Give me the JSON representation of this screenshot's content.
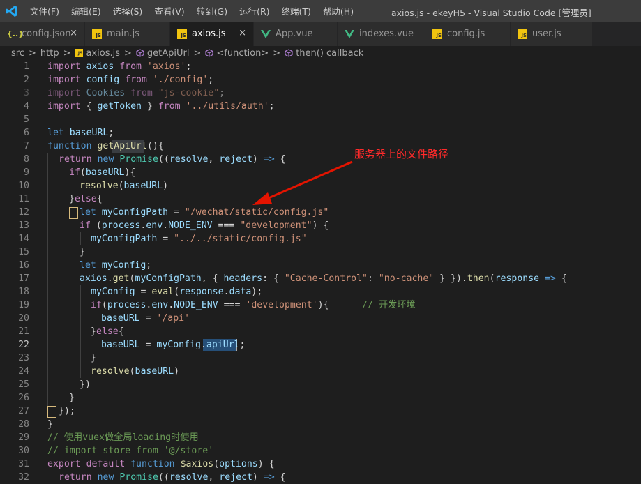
{
  "menu": [
    "文件(F)",
    "编辑(E)",
    "选择(S)",
    "查看(V)",
    "转到(G)",
    "运行(R)",
    "终端(T)",
    "帮助(H)"
  ],
  "window_title": "axios.js - ekeyH5 - Visual Studio Code [管理员]",
  "tabs": [
    {
      "label": "config.json",
      "icon": "json-file-icon",
      "close": "×"
    },
    {
      "label": "main.js",
      "icon": "js-file-icon"
    },
    {
      "label": "axios.js",
      "icon": "js-file-icon",
      "close": "×",
      "active": true
    },
    {
      "label": "App.vue",
      "icon": "vue-file-icon"
    },
    {
      "label": "indexes.vue",
      "icon": "vue-file-icon"
    },
    {
      "label": "config.js",
      "icon": "js-file-icon"
    },
    {
      "label": "user.js",
      "icon": "js-file-icon"
    }
  ],
  "breadcrumb": {
    "sep": ">",
    "items": [
      "src",
      "http",
      "axios.js",
      "getApiUrl",
      "<function>",
      "then() callback"
    ]
  },
  "line_numbers": [
    "1",
    "2",
    "3",
    "4",
    "5",
    "6",
    "7",
    "8",
    "9",
    "10",
    "11",
    "12",
    "13",
    "14",
    "15",
    "16",
    "17",
    "18",
    "19",
    "20",
    "21",
    "22",
    "23",
    "24",
    "25",
    "26",
    "27",
    "28",
    "29",
    "30",
    "31",
    "32"
  ],
  "code": {
    "l1_a": "import ",
    "l1_b": "axios",
    "l1_c": " from ",
    "l1_d": "'axios'",
    "l1_e": ";",
    "l2_a": "import ",
    "l2_b": "config",
    "l2_c": " from ",
    "l2_d": "'./config'",
    "l2_e": ";",
    "l3_a": "import ",
    "l3_b": "Cookies",
    "l3_c": " from ",
    "l3_d": "\"js-cookie\"",
    "l3_e": ";",
    "l4_a": "import ",
    "l4_b": "{ ",
    "l4_c": "getToken",
    "l4_d": " } ",
    "l4_e": "from ",
    "l4_f": "'../utils/auth'",
    "l4_g": ";",
    "l6_a": "let ",
    "l6_b": "baseURL",
    "l6_c": ";",
    "l7_a": "function ",
    "l7_b": "getApiUrl",
    "l7_c": "(){",
    "l8_a": "return ",
    "l8_b": "new ",
    "l8_c": "Promise",
    "l8_d": "((",
    "l8_e": "resolve",
    "l8_f": ", ",
    "l8_g": "reject",
    "l8_h": ") ",
    "l8_i": "=>",
    "l8_j": " {",
    "l9_a": "if",
    "l9_b": "(",
    "l9_c": "baseURL",
    "l9_d": "){",
    "l10_a": "resolve",
    "l10_b": "(",
    "l10_c": "baseURL",
    "l10_d": ")",
    "l11_a": "}",
    "l11_b": "else",
    "l11_c": "{",
    "l12_a": "let ",
    "l12_b": "myConfigPath",
    " l12_c": " = ",
    "l12_d": "\"/wechat/static/config.js\"",
    "l13_a": "if ",
    "l13_b": "(",
    "l13_c": "process",
    "l13_d": ".",
    "l13_e": "env",
    "l13_f": ".",
    "l13_g": "NODE_ENV",
    " l13_h": " === ",
    "l13_i": "\"development\"",
    "l13_j": ") {",
    "l14_a": "myConfigPath",
    "l14_b": " = ",
    "l14_c": "\"../../static/config.js\"",
    "l15_a": "}",
    "l16_a": "let ",
    "l16_b": "myConfig",
    "l16_c": ";",
    "l17_a": "axios",
    "l17_b": ".",
    "l17_c": "get",
    "l17_d": "(",
    "l17_e": "myConfigPath",
    "l17_f": ", { ",
    "l17_g": "headers",
    "l17_h": ": { ",
    "l17_i": "\"Cache-Control\"",
    "l17_j": ": ",
    "l17_k": "\"no-cache\"",
    "l17_l": " } }).",
    "l17_m": "then",
    "l17_n": "(",
    "l17_o": "response",
    "l17_p": " ",
    "l17_q": "=>",
    "l17_r": " {",
    "l18_a": "myConfig",
    "l18_b": " = ",
    "l18_c": "eval",
    "l18_d": "(",
    "l18_e": "response",
    "l18_f": ".",
    "l18_g": "data",
    "l18_h": ");",
    "l19_a": "if",
    "l19_b": "(",
    "l19_c": "process",
    "l19_d": ".",
    "l19_e": "env",
    "l19_f": ".",
    "l19_g": "NODE_ENV",
    "l19_h": " === ",
    "l19_i": "'development'",
    "l19_j": "){",
    "l19_k": "      // 开发环境",
    "l20_a": "baseURL",
    "l20_b": " = ",
    "l20_c": "'/api'",
    "l21_a": "}",
    "l21_b": "else",
    "l21_c": "{",
    "l22_a": "baseURL",
    "l22_b": " = ",
    "l22_c": "myConfig",
    "l22_d": ".",
    "l22_e": "apiUrl",
    "l22_f": ";",
    "l23_a": "}",
    "l24_a": "resolve",
    "l24_b": "(",
    "l24_c": "baseURL",
    "l24_d": ")",
    "l25_a": "})",
    "l26_a": "}",
    "l27_a": "});",
    "l28_a": "}",
    "l29_a": "// 使用vuex做全局loading时使用",
    "l30_a": "// import store from '@/store'",
    "l31_a": "export ",
    "l31_b": "default ",
    "l31_c": "function ",
    "l31_d": "$axios",
    "l31_e": "(",
    "l31_f": "options",
    "l31_g": ") {",
    "l32_a": "return ",
    "l32_b": "new ",
    "l32_c": "Promise",
    "l32_d": "((",
    "l32_e": "resolve",
    "l32_f": ", ",
    "l32_g": "reject",
    "l32_h": ") ",
    "l32_i": "=>",
    "l32_j": " {"
  },
  "annotation": {
    "text": "服务器上的文件路径",
    "color": "#ff2a2a"
  },
  "colors": {
    "keyword": "#569cd6",
    "control": "#c586c0",
    "string": "#ce9178",
    "variable": "#9cdcfe",
    "function": "#dcdcaa",
    "comment": "#6a9955",
    "highlight_box": "#e51400"
  }
}
